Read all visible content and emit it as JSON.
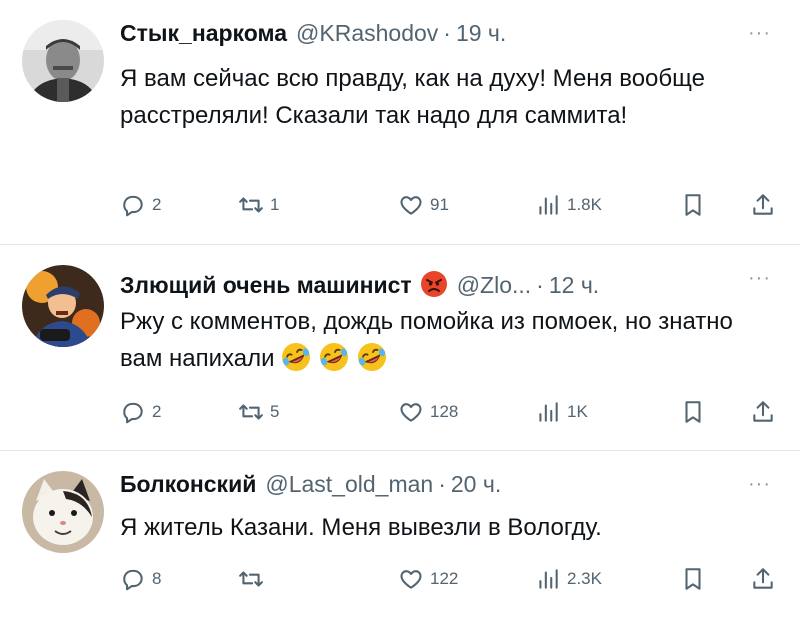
{
  "tweets": [
    {
      "name": "Стык_наркома",
      "handle": "@KRashodov",
      "dot": "·",
      "time": "19 ч.",
      "more": "···",
      "text": "Я вам сейчас всю правду, как на духу! Меня вообще расстреляли! Сказали так надо для саммита!",
      "replies": "2",
      "retweets": "1",
      "likes": "91",
      "views": "1.8K"
    },
    {
      "name": "Злющий очень машинист",
      "handle": "@Zlo...",
      "dot": "·",
      "time": "12 ч.",
      "more": "···",
      "text": "Ржу с комментов, дождь помойка из помоек, но знатно вам напихали",
      "replies": "2",
      "retweets": "5",
      "likes": "128",
      "views": "1K"
    },
    {
      "name": "Болконский",
      "handle": "@Last_old_man",
      "dot": "·",
      "time": "20 ч.",
      "more": "···",
      "text": "Я житель Казани. Меня вывезли в Вологду.",
      "replies": "8",
      "retweets": "",
      "likes": "122",
      "views": "2.3K"
    }
  ],
  "colors": {
    "text": "#0f1419",
    "secondary": "#536471",
    "divider": "#e3e7ea"
  },
  "icons": [
    "reply-icon",
    "retweet-icon",
    "like-icon",
    "views-icon",
    "bookmark-icon",
    "share-icon",
    "more-icon",
    "angry-face-icon",
    "rofl-emoji-icon"
  ]
}
